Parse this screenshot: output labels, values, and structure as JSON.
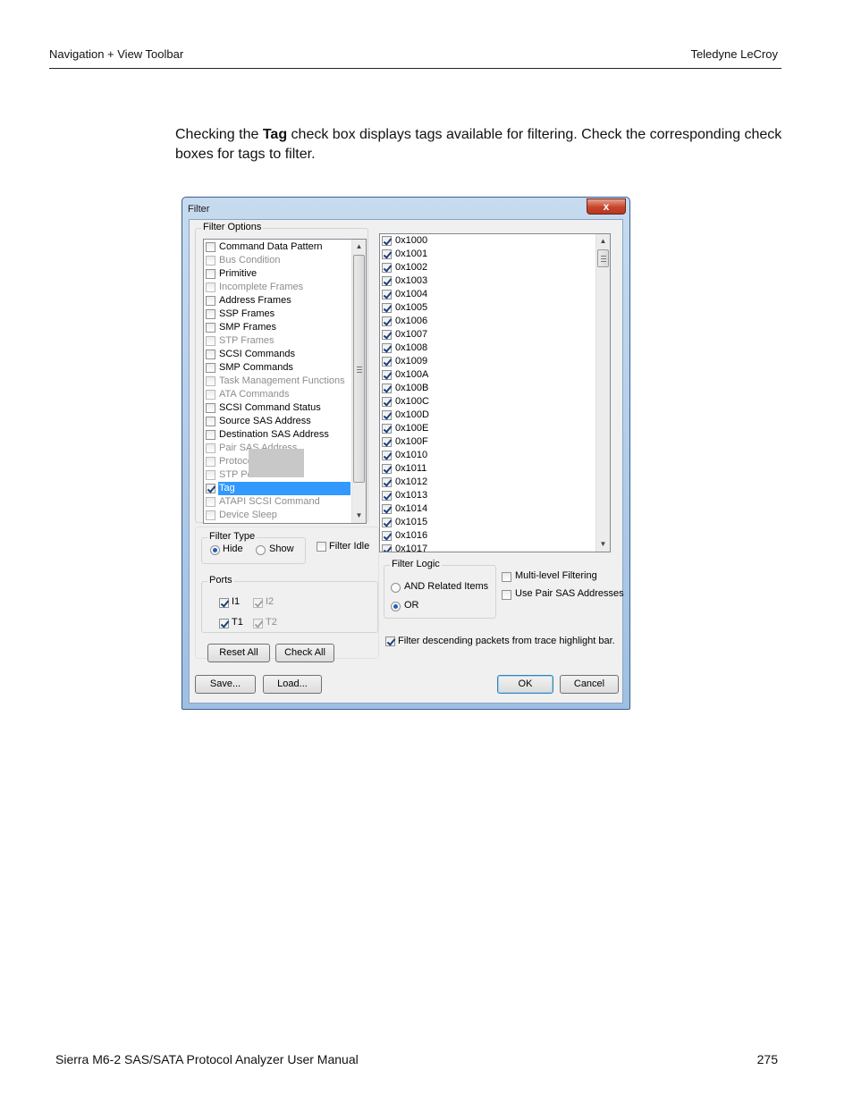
{
  "header": {
    "left": "Navigation + View Toolbar",
    "right": "Teledyne  LeCroy"
  },
  "intro": {
    "before": "Checking the ",
    "bold": "Tag",
    "after": " check box displays tags available for filtering. Check the corresponding check boxes for tags to filter."
  },
  "footer": {
    "left": "Sierra M6-2 SAS/SATA Protocol Analyzer User Manual",
    "right": "275"
  },
  "dialog": {
    "title": "Filter",
    "close": "x",
    "filter_options": {
      "legend": "Filter Options",
      "items": [
        {
          "label": "Command Data Pattern",
          "checked": false,
          "enabled": true
        },
        {
          "label": "Bus Condition",
          "checked": false,
          "enabled": false
        },
        {
          "label": "Primitive",
          "checked": false,
          "enabled": true
        },
        {
          "label": "Incomplete Frames",
          "checked": false,
          "enabled": false
        },
        {
          "label": "Address Frames",
          "checked": false,
          "enabled": true
        },
        {
          "label": "SSP Frames",
          "checked": false,
          "enabled": true
        },
        {
          "label": "SMP Frames",
          "checked": false,
          "enabled": true
        },
        {
          "label": "STP Frames",
          "checked": false,
          "enabled": false
        },
        {
          "label": "SCSI Commands",
          "checked": false,
          "enabled": true
        },
        {
          "label": "SMP Commands",
          "checked": false,
          "enabled": true
        },
        {
          "label": "Task Management Functions",
          "checked": false,
          "enabled": false
        },
        {
          "label": "ATA Commands",
          "checked": false,
          "enabled": false
        },
        {
          "label": "SCSI Command Status",
          "checked": false,
          "enabled": true
        },
        {
          "label": "Source SAS Address",
          "checked": false,
          "enabled": true
        },
        {
          "label": "Destination SAS Address",
          "checked": false,
          "enabled": true
        },
        {
          "label": "Pair SAS Address",
          "checked": false,
          "enabled": false
        },
        {
          "label": "Protocol",
          "checked": false,
          "enabled": false
        },
        {
          "label": "STP Port",
          "checked": false,
          "enabled": false
        },
        {
          "label": "Tag",
          "checked": true,
          "enabled": true,
          "selected": true
        },
        {
          "label": "ATAPI SCSI Command",
          "checked": false,
          "enabled": false
        },
        {
          "label": "Device Sleep",
          "checked": false,
          "enabled": false
        }
      ]
    },
    "tags": [
      {
        "label": "0x1000",
        "checked": true
      },
      {
        "label": "0x1001",
        "checked": true
      },
      {
        "label": "0x1002",
        "checked": true
      },
      {
        "label": "0x1003",
        "checked": true
      },
      {
        "label": "0x1004",
        "checked": true
      },
      {
        "label": "0x1005",
        "checked": true
      },
      {
        "label": "0x1006",
        "checked": true
      },
      {
        "label": "0x1007",
        "checked": true
      },
      {
        "label": "0x1008",
        "checked": true
      },
      {
        "label": "0x1009",
        "checked": true
      },
      {
        "label": "0x100A",
        "checked": true
      },
      {
        "label": "0x100B",
        "checked": true
      },
      {
        "label": "0x100C",
        "checked": true
      },
      {
        "label": "0x100D",
        "checked": true
      },
      {
        "label": "0x100E",
        "checked": true
      },
      {
        "label": "0x100F",
        "checked": true
      },
      {
        "label": "0x1010",
        "checked": true
      },
      {
        "label": "0x1011",
        "checked": true
      },
      {
        "label": "0x1012",
        "checked": true
      },
      {
        "label": "0x1013",
        "checked": true
      },
      {
        "label": "0x1014",
        "checked": true
      },
      {
        "label": "0x1015",
        "checked": true
      },
      {
        "label": "0x1016",
        "checked": true
      },
      {
        "label": "0x1017",
        "checked": true
      }
    ],
    "filter_type": {
      "legend": "Filter Type",
      "hide": "Hide",
      "show": "Show",
      "selected": "hide"
    },
    "filter_idle": {
      "label": "Filter Idle",
      "checked": false
    },
    "ports": {
      "legend": "Ports",
      "i1": {
        "label": "I1",
        "checked": true,
        "enabled": true
      },
      "i2": {
        "label": "I2",
        "checked": true,
        "enabled": false
      },
      "t1": {
        "label": "T1",
        "checked": true,
        "enabled": true
      },
      "t2": {
        "label": "T2",
        "checked": true,
        "enabled": false
      }
    },
    "reset_all": "Reset All",
    "check_all": "Check All",
    "filter_logic": {
      "legend": "Filter Logic",
      "and": "AND Related Items",
      "or": "OR",
      "selected": "or"
    },
    "multi_level": {
      "label": "Multi-level Filtering",
      "checked": false
    },
    "use_pair": {
      "label": "Use Pair SAS Addresses",
      "checked": false
    },
    "filter_descending": {
      "label": "Filter descending packets from trace highlight bar.",
      "checked": true
    },
    "save": "Save...",
    "load": "Load...",
    "ok": "OK",
    "cancel": "Cancel"
  }
}
